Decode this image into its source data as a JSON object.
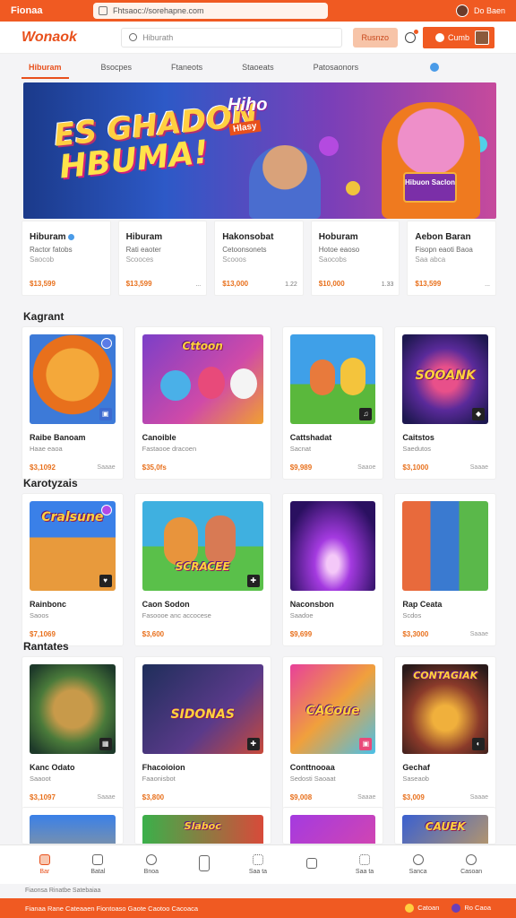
{
  "topbar": {
    "brand": "Fionaa",
    "url": "Fhtsaoc://sorehapne.com",
    "user": "Do Baen"
  },
  "header": {
    "logo": "Wonaok",
    "search_placeholder": "Hiburath",
    "cta": "Rusnzo",
    "user_label": "Cumb"
  },
  "tabs": [
    "Hiburam",
    "Bsocpes",
    "Ftaneots",
    "Staoeats",
    "Patosaonors"
  ],
  "hero": {
    "line1": "ES GHADON",
    "line2": "HBUMA!",
    "side": "Hiho",
    "tag": "Hlasy",
    "badge": "Hibuon Saclon"
  },
  "featured": [
    {
      "title": "Hiburam",
      "sub1": "Ractor fatobs",
      "sub2": "Saocob",
      "price": "$13,599",
      "note": ""
    },
    {
      "title": "Hiburam",
      "sub1": "Rati eaoter",
      "sub2": "Scooces",
      "price": "$13,599",
      "note": "..."
    },
    {
      "title": "Hakonsobat",
      "sub1": "Cetoonsonets",
      "sub2": "Scooos",
      "price": "$13,000",
      "note": "1.22"
    },
    {
      "title": "Hoburam",
      "sub1": "Hotoe eaoso",
      "sub2": "Saocobs",
      "price": "$10,000",
      "note": "1.33"
    },
    {
      "title": "Aebon Baran",
      "sub1": "Fisopn eaoti Baoa",
      "sub2": "Saa abca",
      "price": "$13,599",
      "note": "..."
    }
  ],
  "sections": {
    "s1": "Kagrant",
    "s2": "Karotyzais",
    "s3": "Rantates"
  },
  "row1": [
    {
      "title": "Raibe Banoam",
      "sub": "Haae eaoa",
      "price": "$3,1092",
      "note": "Saaae",
      "text": ""
    },
    {
      "title": "Canoible",
      "sub": "Fastaooe dracoen",
      "price": "$35,0fs",
      "note": "",
      "text": "Cttoon"
    },
    {
      "title": "Cattshadat",
      "sub": "Sacnat",
      "price": "$9,989",
      "note": "Saaoe",
      "text": ""
    },
    {
      "title": "Caitstos",
      "sub": "Saedutos",
      "price": "$3,1000",
      "note": "Saaae",
      "text": "SOOANK"
    }
  ],
  "row2": [
    {
      "title": "Rainbonc",
      "sub": "Saoos",
      "price": "$7,1069",
      "note": "",
      "text": "Cralsune"
    },
    {
      "title": "Caon Sodon",
      "sub": "Fasoooe anc accocese",
      "price": "$3,600",
      "note": "",
      "text": "SCRACEE"
    },
    {
      "title": "Naconsbon",
      "sub": "Saadoe",
      "price": "$9,699",
      "note": "",
      "text": ""
    },
    {
      "title": "Rap Ceata",
      "sub": "Scdos",
      "price": "$3,3000",
      "note": "Saaae",
      "text": ""
    }
  ],
  "row3": [
    {
      "title": "Kanc Odato",
      "sub": "Saaoot",
      "price": "$3,1097",
      "note": "Saaae",
      "text": ""
    },
    {
      "title": "Fhacoioion",
      "sub": "Faaonisbot",
      "price": "$3,800",
      "note": "",
      "text": "SIDONAS"
    },
    {
      "title": "Conttnooaa",
      "sub": "Sedosti Saoaat",
      "price": "$9,008",
      "note": "Saaae",
      "text": "CACoue"
    },
    {
      "title": "Gechaf",
      "sub": "Saseaob",
      "price": "$3,009",
      "note": "Saaae",
      "text": "CONTAGIAK"
    }
  ],
  "row4": [
    {
      "text": ""
    },
    {
      "text": "Slaboc"
    },
    {
      "text": ""
    },
    {
      "text": "CAUEK"
    }
  ],
  "nav": [
    "Bar",
    "Batal",
    "Bnoa",
    "",
    "Saa ta",
    "",
    "Saa ta",
    "Sanca",
    "Casoan"
  ],
  "legal": "Fiaonsa Rinatbe Satebaiaa",
  "footer": {
    "left": "Fianaa Rane Cateaaen   Fiontoaso Gaote Caotoo Cacoaca",
    "r1": "Catoan",
    "r2": "Ro Caoa"
  },
  "colors": {
    "accent": "#f05a22",
    "price": "#e8701c",
    "link": "#4a9be8"
  }
}
